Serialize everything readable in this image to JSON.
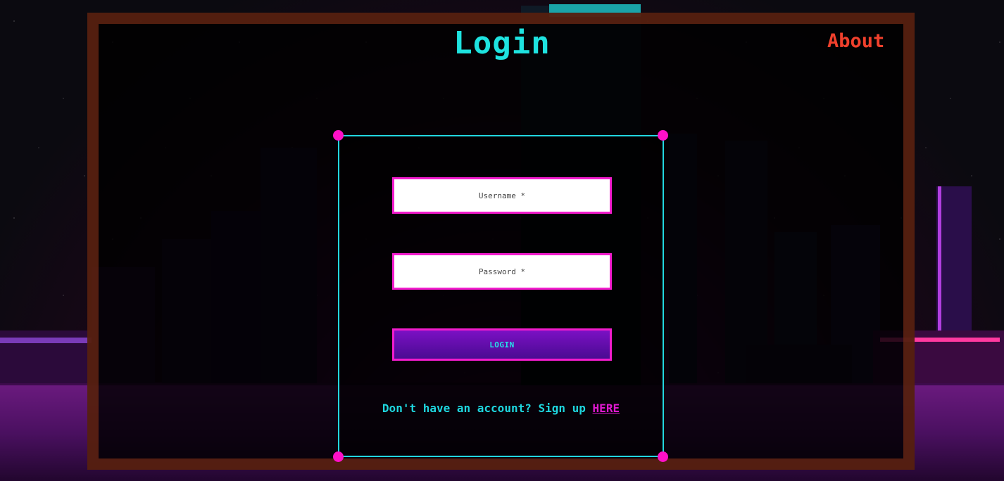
{
  "header": {
    "title": "Login",
    "about_label": "About"
  },
  "form": {
    "username_placeholder": "Username *",
    "username_value": "",
    "password_placeholder": "Password *",
    "password_value": "",
    "login_label": "LOGIN",
    "signup_prompt": "Don't have an account? Sign up",
    "signup_link_label": "HERE"
  },
  "colors": {
    "title": "#1ee3e0",
    "about": "#f0402c",
    "accent_pink": "#f21ccd",
    "card_border": "#22d6e0",
    "button_gradient_top": "#7b10c4",
    "button_gradient_bottom": "#4a0b92"
  }
}
